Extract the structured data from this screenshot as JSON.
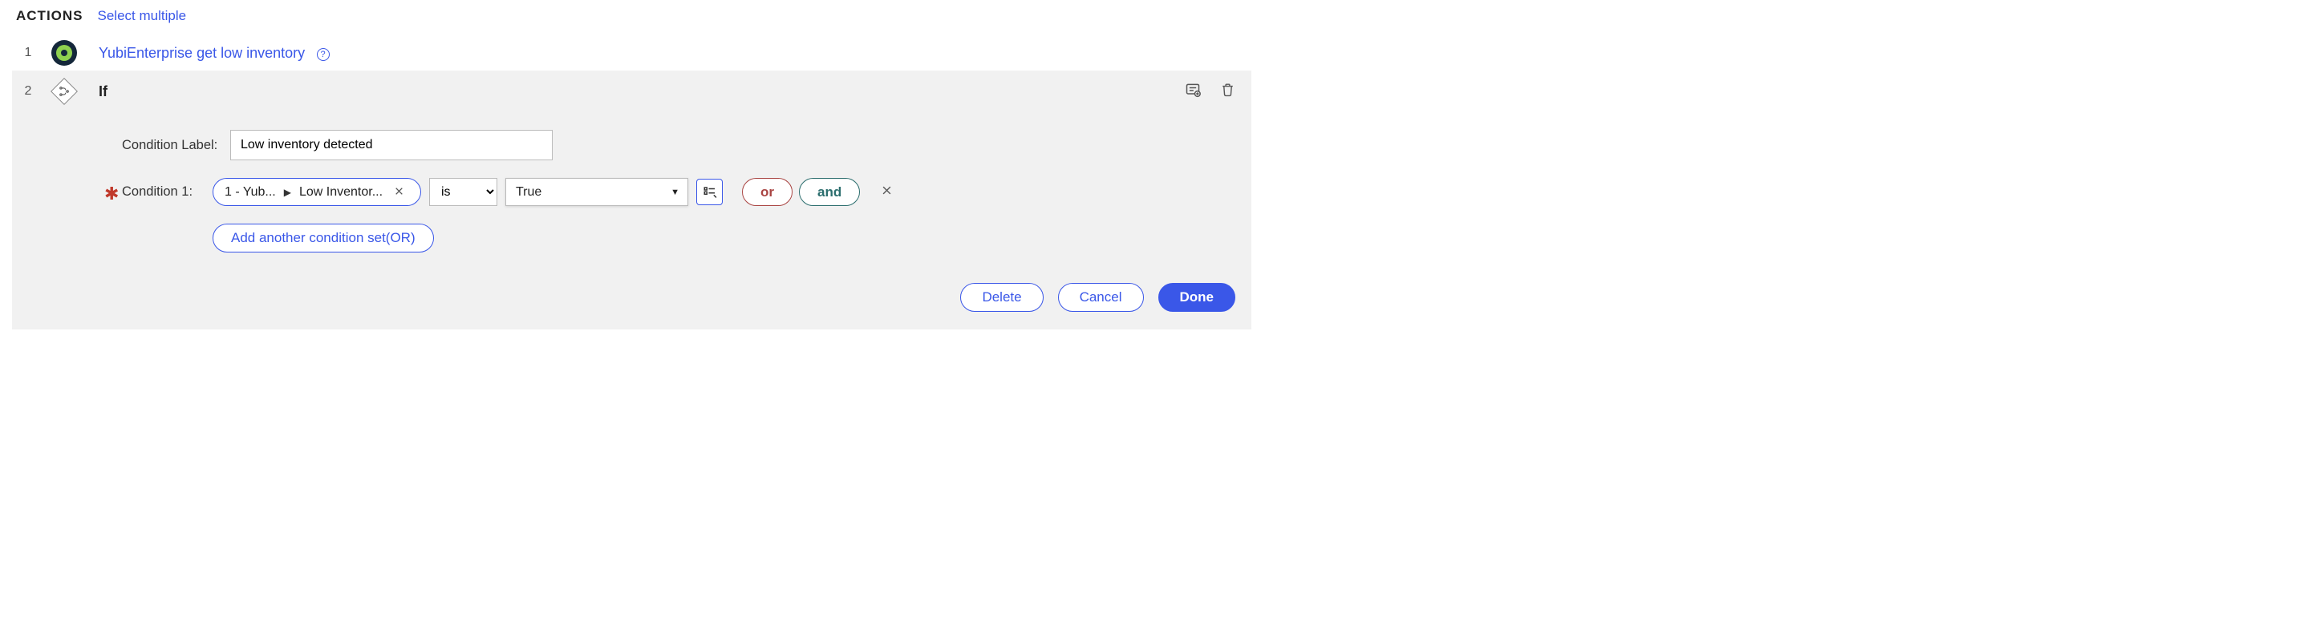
{
  "header": {
    "title": "ACTIONS",
    "select_multiple": "Select multiple"
  },
  "steps": {
    "s1": {
      "num": "1",
      "label": "YubiEnterprise get low inventory"
    },
    "s2": {
      "num": "2",
      "label": "If"
    }
  },
  "form": {
    "condition_label_label": "Condition Label:",
    "condition_label_value": "Low inventory detected",
    "condition_1_label": "Condition 1:",
    "pill_left": "1 - Yub...",
    "pill_right": "Low Inventor...",
    "operator": "is",
    "value": "True",
    "or": "or",
    "and": "and",
    "add_set": "Add another condition set(OR)"
  },
  "footer": {
    "delete": "Delete",
    "cancel": "Cancel",
    "done": "Done"
  }
}
